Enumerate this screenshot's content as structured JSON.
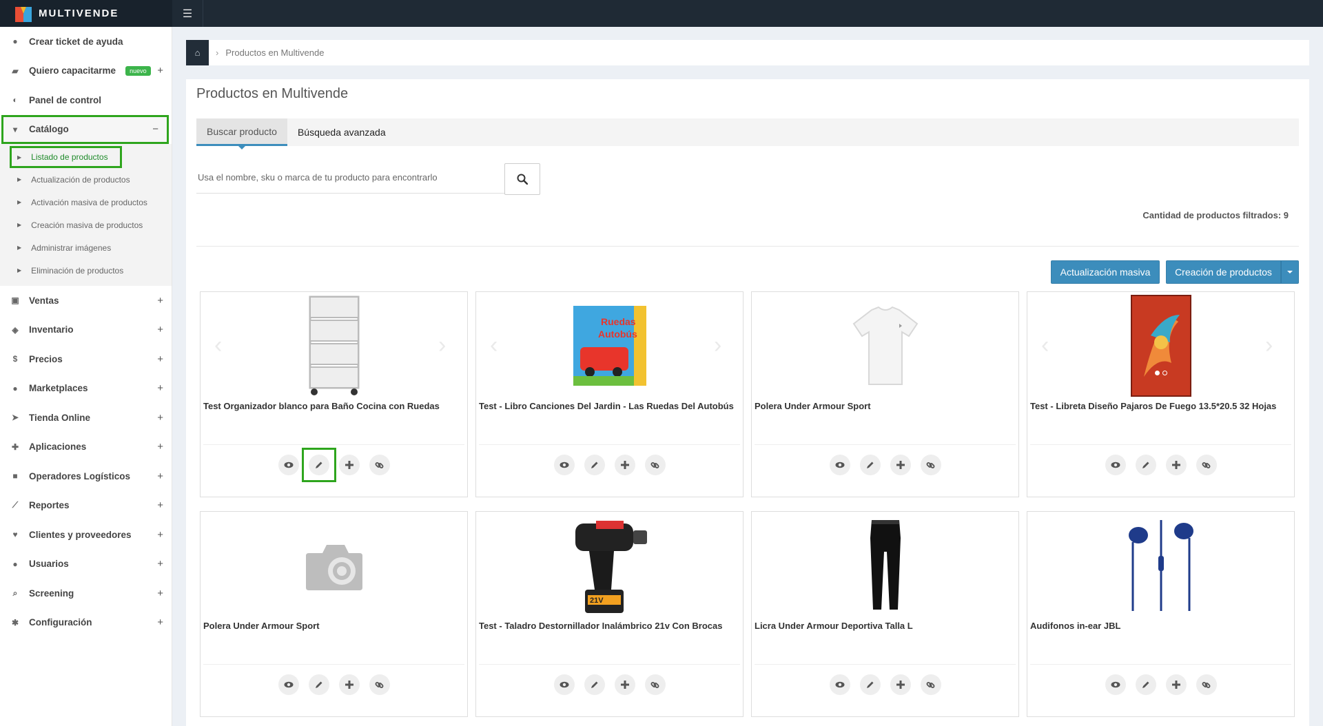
{
  "brand": {
    "name": "MULTIVENDE"
  },
  "sidebar": {
    "items": [
      {
        "label": "Crear ticket de ayuda",
        "icon": "question-circle-icon",
        "plus": ""
      },
      {
        "label": "Quiero capacitarme",
        "icon": "graduation-cap-icon",
        "plus": "+",
        "badge": "nuevo"
      },
      {
        "label": "Panel de control",
        "icon": "dashboard-icon",
        "plus": ""
      },
      {
        "label": "Catálogo",
        "icon": "cart-icon",
        "plus": "−"
      },
      {
        "label": "Ventas",
        "icon": "money-icon",
        "plus": "+"
      },
      {
        "label": "Inventario",
        "icon": "cubes-icon",
        "plus": "+"
      },
      {
        "label": "Precios",
        "icon": "dollar-icon",
        "plus": "+"
      },
      {
        "label": "Marketplaces",
        "icon": "globe-icon",
        "plus": "+"
      },
      {
        "label": "Tienda Online",
        "icon": "pointer-icon",
        "plus": "+"
      },
      {
        "label": "Aplicaciones",
        "icon": "puzzle-icon",
        "plus": "+"
      },
      {
        "label": "Operadores Logísticos",
        "icon": "truck-icon",
        "plus": "+"
      },
      {
        "label": "Reportes",
        "icon": "line-chart-icon",
        "plus": "+"
      },
      {
        "label": "Clientes y proveedores",
        "icon": "heart-icon",
        "plus": "+"
      },
      {
        "label": "Usuarios",
        "icon": "user-icon",
        "plus": "+"
      },
      {
        "label": "Screening",
        "icon": "search-icon",
        "plus": "+"
      },
      {
        "label": "Configuración",
        "icon": "gear-icon",
        "plus": "+"
      }
    ],
    "catalog_sub": [
      "Listado de productos",
      "Actualización de productos",
      "Activación masiva de productos",
      "Creación masiva de productos",
      "Administrar imágenes",
      "Eliminación de productos"
    ]
  },
  "breadcrumb": {
    "current": "Productos en Multivende"
  },
  "main": {
    "title": "Productos en Multivende",
    "tabs": [
      "Buscar producto",
      "Búsqueda avanzada"
    ],
    "search_placeholder": "Usa el nombre, sku o marca de tu producto para encontrarlo",
    "count_text": "Cantidad de productos filtrados: 9",
    "btn_mass": "Actualización masiva",
    "btn_create": "Creación de productos"
  },
  "products": [
    {
      "name": "Test Organizador blanco para Baño Cocina con Ruedas",
      "image": "shelf-cart"
    },
    {
      "name": "Test - Libro Canciones Del Jardin - Las Ruedas Del Autobús",
      "image": "book"
    },
    {
      "name": "Polera Under Armour Sport",
      "image": "tshirt"
    },
    {
      "name": "Test - Libreta Diseño Pajaros De Fuego 13.5*20.5 32 Hojas",
      "image": "notebook"
    },
    {
      "name": "Polera Under Armour Sport",
      "image": "camera-placeholder"
    },
    {
      "name": "Test - Taladro Destornillador Inalámbrico 21v Con Brocas",
      "image": "drill"
    },
    {
      "name": "Licra Under Armour Deportiva Talla L",
      "image": "leggings"
    },
    {
      "name": "Audifonos in-ear JBL",
      "image": "earphones"
    }
  ],
  "colors": {
    "primary": "#3c8dbc",
    "highlight": "#2ea51d",
    "topbar": "#1f2a35"
  }
}
